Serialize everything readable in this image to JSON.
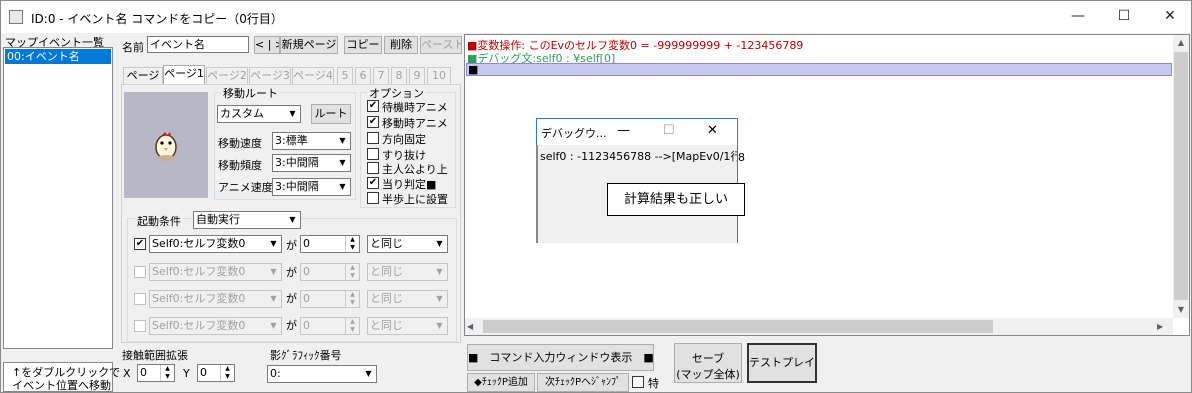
{
  "window": {
    "title": "ID:0 - イベント名 コマンドをコピー（0行目）",
    "minimize": "—",
    "maximize": "☐",
    "close": "✕"
  },
  "event_list": {
    "header": "マップイベント一覧",
    "items": [
      "00:イベント名"
    ],
    "hint_line1": "↑をダブルクリックで",
    "hint_line2": "イベント位置へ移動"
  },
  "name_row": {
    "label": "名前",
    "value": "イベント名",
    "prev_next": "< | >",
    "new_page": "新規ページ",
    "copy": "コピー",
    "delete": "削除",
    "paste": "ペースト"
  },
  "page_tabs": [
    "ページ",
    "ページ1",
    "ページ2",
    "ページ3",
    "ページ4",
    "5",
    "6",
    "7",
    "8",
    "9",
    "10"
  ],
  "movement": {
    "group_label": "移動ルート",
    "route_value": "カスタム",
    "route_button": "ルート",
    "speed_label": "移動速度",
    "speed_value": "3:標準",
    "freq_label": "移動頻度",
    "freq_value": "3:中間隔",
    "anim_label": "アニメ速度",
    "anim_value": "3:中間隔"
  },
  "options": {
    "group_label": "オプション",
    "items": [
      {
        "label": "待機時アニメ",
        "checked": "✔"
      },
      {
        "label": "移動時アニメ",
        "checked": "✔"
      },
      {
        "label": "方向固定",
        "checked": ""
      },
      {
        "label": "すり抜け",
        "checked": ""
      },
      {
        "label": "主人公より上",
        "checked": ""
      },
      {
        "label": "当り判定■",
        "checked": "✔"
      },
      {
        "label": "半歩上に設置",
        "checked": ""
      }
    ]
  },
  "trigger": {
    "label": "起動条件",
    "value": "自動実行",
    "conditions": [
      {
        "checked": "✔",
        "var": "Self0:セルフ変数0",
        "ga": "が",
        "num": "0",
        "op": "と同じ"
      },
      {
        "checked": "",
        "var": "Self0:セルフ変数0",
        "ga": "が",
        "num": "0",
        "op": "と同じ"
      },
      {
        "checked": "",
        "var": "Self0:セルフ変数0",
        "ga": "が",
        "num": "0",
        "op": "と同じ"
      },
      {
        "checked": "",
        "var": "Self0:セルフ変数0",
        "ga": "が",
        "num": "0",
        "op": "と同じ"
      }
    ]
  },
  "contact": {
    "label": "接触範囲拡張",
    "x_label": "X",
    "x_value": "0",
    "y_label": "Y",
    "y_value": "0"
  },
  "shadow": {
    "label": "影ｸﾞﾗﾌｨｯｸ番号",
    "value": "0:"
  },
  "commands": {
    "lines": [
      {
        "text": "■変数操作: このEvのセルフ変数0 = -999999999 + -123456789",
        "color": "#c00000"
      },
      {
        "text": "■デバッグ文:self0 : ¥self[0]",
        "color": "#2e9e5a"
      },
      {
        "text": "■",
        "color": "#000000"
      }
    ]
  },
  "debug_window": {
    "title": "デバッグウ...",
    "minimize": "—",
    "maximize": "☐",
    "close": "✕",
    "text": "self0 : -1123456788 -->[MapEv0/1行",
    "overflow": "8"
  },
  "callout": "計算結果も正しい",
  "bottom": {
    "cmd_input": "■　コマンド入力ウィンドウ表示　■",
    "add_check": "◆ﾁｪｯｸP追加",
    "next_check": "次ﾁｪｯｸPへｼﾞｬﾝﾌﾟ",
    "special": "特",
    "save_line1": "セーブ",
    "save_line2": "(マップ全体)",
    "test_play": "テストプレイ"
  }
}
